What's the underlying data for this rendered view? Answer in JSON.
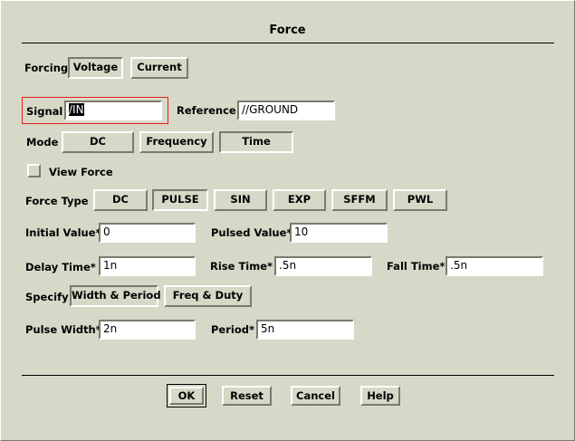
{
  "dialog": {
    "title": "Force",
    "forcing": {
      "label": "Forcing",
      "options": [
        "Voltage",
        "Current"
      ],
      "selected": "Voltage"
    },
    "signal": {
      "label": "Signal",
      "value": "/IN"
    },
    "reference": {
      "label": "Reference",
      "value": "//GROUND"
    },
    "mode": {
      "label": "Mode",
      "options": [
        "DC",
        "Frequency",
        "Time"
      ],
      "selected": "Time"
    },
    "view_force": {
      "label": "View Force",
      "checked": false
    },
    "force_type": {
      "label": "Force Type",
      "options": [
        "DC",
        "PULSE",
        "SIN",
        "EXP",
        "SFFM",
        "PWL"
      ],
      "selected": "PULSE"
    },
    "initial_value": {
      "label": "Initial Value*",
      "value": "0"
    },
    "pulsed_value": {
      "label": "Pulsed Value*",
      "value": "10"
    },
    "delay_time": {
      "label": "Delay Time*",
      "value": "1n"
    },
    "rise_time": {
      "label": "Rise Time*",
      "value": ".5n"
    },
    "fall_time": {
      "label": "Fall Time*",
      "value": ".5n"
    },
    "specify": {
      "label": "Specify",
      "options": [
        "Width & Period",
        "Freq & Duty"
      ],
      "selected": "Width & Period"
    },
    "pulse_width": {
      "label": "Pulse Width*",
      "value": "2n"
    },
    "period": {
      "label": "Period*",
      "value": "5n"
    },
    "footer": {
      "ok": "OK",
      "reset": "Reset",
      "cancel": "Cancel",
      "help": "Help"
    }
  }
}
